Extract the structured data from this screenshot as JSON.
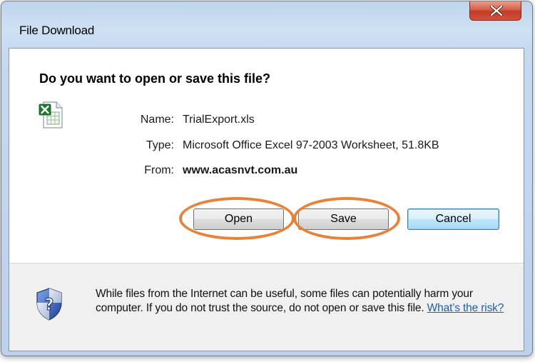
{
  "window": {
    "title": "File Download"
  },
  "dialog": {
    "question": "Do you want to open or save this file?",
    "fields": {
      "name_label": "Name:",
      "name_value": "TrialExport.xls",
      "type_label": "Type:",
      "type_value": "Microsoft Office Excel 97-2003 Worksheet, 51.8KB",
      "from_label": "From:",
      "from_value": "www.acasnvt.com.au"
    },
    "buttons": {
      "open": "Open",
      "save": "Save",
      "cancel": "Cancel"
    },
    "warning": {
      "text": "While files from the Internet can be useful, some files can potentially harm your computer. If you do not trust the source, do not open or save this file.",
      "link": "What’s the risk?"
    }
  },
  "icons": {
    "close": "close-icon",
    "file": "excel-file-icon",
    "shield": "security-shield-icon"
  },
  "colors": {
    "highlight": "#e8823a",
    "link": "#1a5fb4",
    "close_button": "#c43b25"
  }
}
